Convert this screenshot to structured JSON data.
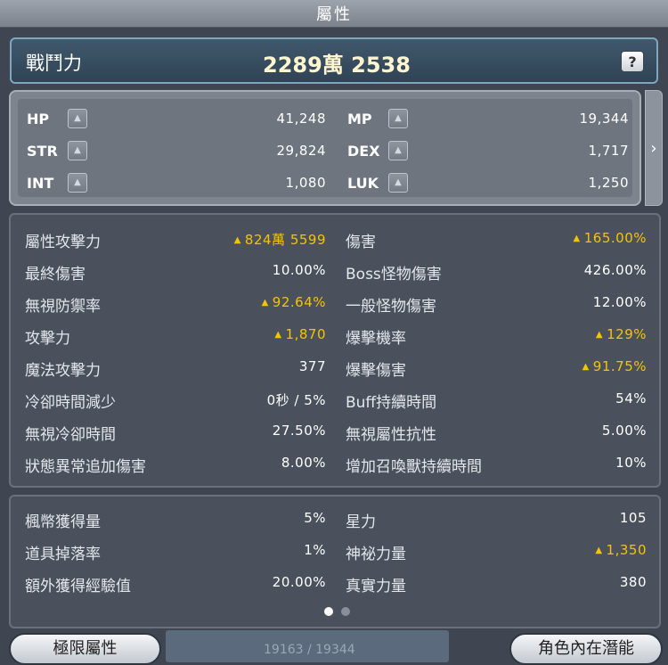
{
  "window": {
    "title": "屬性"
  },
  "combat_power": {
    "label": "戰鬥力",
    "value": "2289萬 2538",
    "help_label": "?"
  },
  "base_stats": [
    {
      "name": "HP",
      "value": "41,248"
    },
    {
      "name": "MP",
      "value": "19,344"
    },
    {
      "name": "STR",
      "value": "29,824"
    },
    {
      "name": "DEX",
      "value": "1,717"
    },
    {
      "name": "INT",
      "value": "1,080"
    },
    {
      "name": "LUK",
      "value": "1,250"
    }
  ],
  "detail_stats": [
    {
      "name": "屬性攻擊力",
      "value": "824萬 5599",
      "up": true
    },
    {
      "name": "傷害",
      "value": "165.00%",
      "up": true
    },
    {
      "name": "最終傷害",
      "value": "10.00%",
      "up": false
    },
    {
      "name": "Boss怪物傷害",
      "value": "426.00%",
      "up": false
    },
    {
      "name": "無視防禦率",
      "value": "92.64%",
      "up": true
    },
    {
      "name": "一般怪物傷害",
      "value": "12.00%",
      "up": false
    },
    {
      "name": "攻擊力",
      "value": "1,870",
      "up": true
    },
    {
      "name": "爆擊機率",
      "value": "129%",
      "up": true
    },
    {
      "name": "魔法攻擊力",
      "value": "377",
      "up": false
    },
    {
      "name": "爆擊傷害",
      "value": "91.75%",
      "up": true
    },
    {
      "name": "冷卻時間減少",
      "value": "0秒 / 5%",
      "up": false
    },
    {
      "name": "Buff持續時間",
      "value": "54%",
      "up": false
    },
    {
      "name": "無視冷卻時間",
      "value": "27.50%",
      "up": false
    },
    {
      "name": "無視屬性抗性",
      "value": "5.00%",
      "up": false
    },
    {
      "name": "狀態異常追加傷害",
      "value": "8.00%",
      "up": false
    },
    {
      "name": "增加召喚獸持續時間",
      "value": "10%",
      "up": false
    }
  ],
  "extra_stats": [
    {
      "name": "楓幣獲得量",
      "value": "5%",
      "up": false
    },
    {
      "name": "星力",
      "value": "105",
      "up": false
    },
    {
      "name": "道具掉落率",
      "value": "1%",
      "up": false
    },
    {
      "name": "神祕力量",
      "value": "1,350",
      "up": true
    },
    {
      "name": "額外獲得經驗值",
      "value": "20.00%",
      "up": false
    },
    {
      "name": "真實力量",
      "value": "380",
      "up": false
    }
  ],
  "pagination": {
    "current": 1,
    "total": 2
  },
  "buttons": {
    "hyper_stats": "極限屬性",
    "inner_ability": "角色內在潛能"
  },
  "background": {
    "mp_bar_text": "19163 / 19344"
  },
  "colors": {
    "up_highlight": "#f5c400",
    "power_panel": "#34495b",
    "active_dot": "#ffffff",
    "inactive_dot": "#8a9099"
  }
}
